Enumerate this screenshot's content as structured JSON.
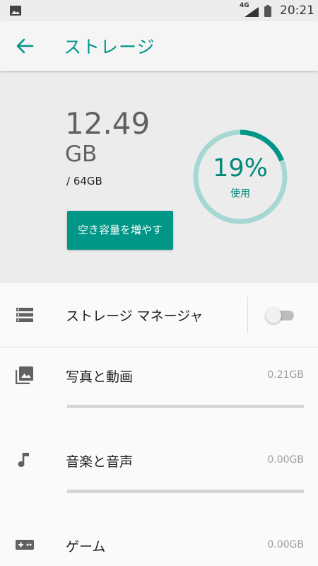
{
  "status_bar": {
    "network": "4G",
    "time": "20:21",
    "icons": [
      "gallery-icon",
      "signal-icon",
      "battery-icon"
    ]
  },
  "app_bar": {
    "title": "ストレージ",
    "back_icon": "arrow-back-icon"
  },
  "summary": {
    "used_value": "12.49",
    "used_unit": "GB",
    "total": "/ 64GB",
    "free_up_button": "空き容量を増やす",
    "percent_text": "19%",
    "percent_value": 19,
    "percent_label": "使用"
  },
  "storage_manager": {
    "label": "ストレージ マネージャ",
    "enabled": false,
    "icon": "storage-list-icon"
  },
  "categories": [
    {
      "label": "写真と動画",
      "size": "0.21GB",
      "icon": "photo-icon",
      "usage_fraction": 0.0
    },
    {
      "label": "音楽と音声",
      "size": "0.00GB",
      "icon": "music-note-icon",
      "usage_fraction": 0.0
    },
    {
      "label": "ゲーム",
      "size": "0.00GB",
      "icon": "gamepad-icon",
      "usage_fraction": 0.0
    }
  ],
  "colors": {
    "accent": "#009688",
    "ring_track": "#a6d8d3",
    "summary_bg": "#ececec",
    "bar_track": "#d6d6d6"
  }
}
